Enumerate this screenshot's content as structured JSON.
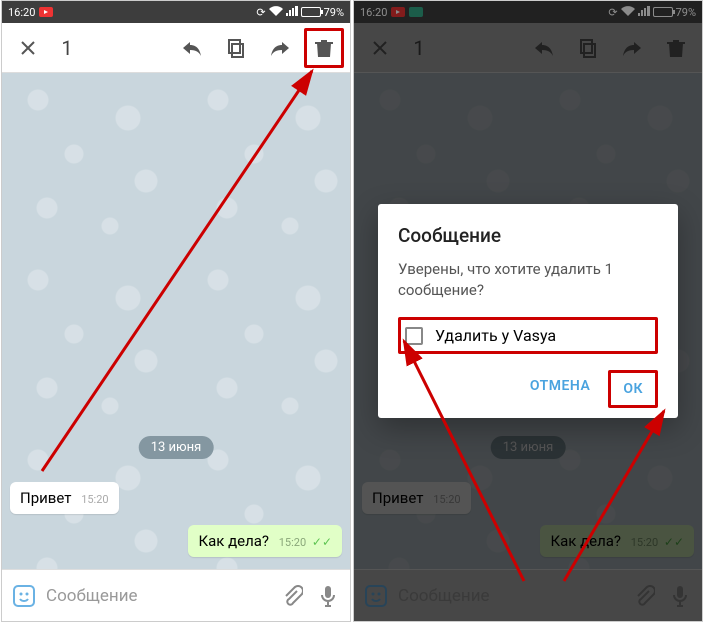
{
  "statusbar": {
    "time": "16:20",
    "battery": "79%"
  },
  "toolbar": {
    "selected_count": "1"
  },
  "chat": {
    "date_badge": "13 июня",
    "msg_in": {
      "text": "Привет",
      "time": "15:20"
    },
    "msg_out": {
      "text": "Как дела?",
      "time": "15:20"
    },
    "input_placeholder": "Сообщение"
  },
  "dialog": {
    "title": "Сообщение",
    "body": "Уверены, что хотите удалить 1 сообщение?",
    "checkbox_label": "Удалить у Vasya",
    "cancel": "ОТМЕНА",
    "ok": "ОК"
  }
}
